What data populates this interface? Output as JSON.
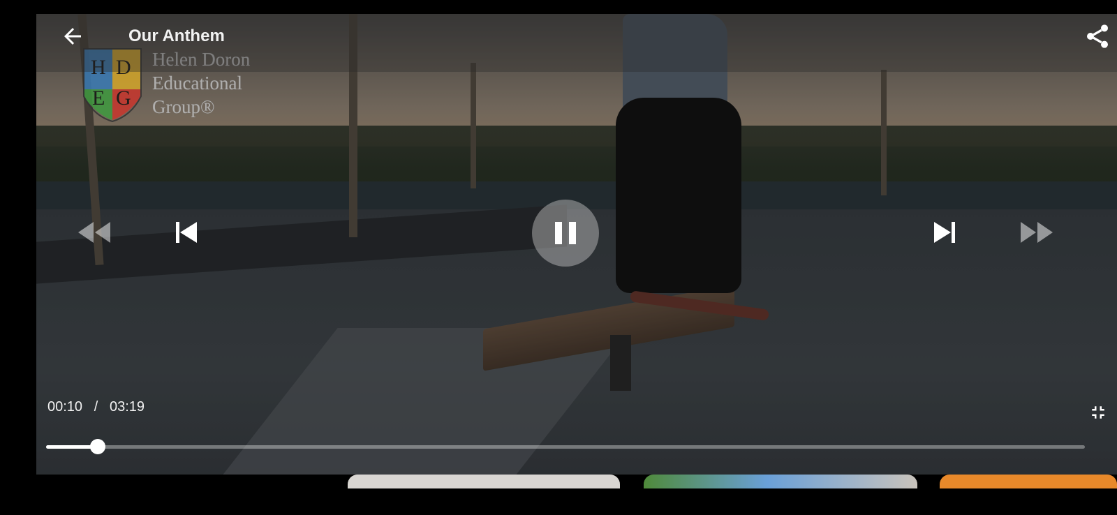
{
  "video": {
    "title": "Our Anthem",
    "current_time": "00:10",
    "separator": "/",
    "duration": "03:19",
    "progress_fraction": 0.05,
    "playing": true
  },
  "logo": {
    "letters": [
      "H",
      "D",
      "E",
      "G"
    ],
    "text_lines": [
      "Helen Doron",
      "Educational",
      "Group®"
    ]
  },
  "icons": {
    "back": "arrow-left-icon",
    "share": "share-icon",
    "rewind": "rewind-icon",
    "previous": "skip-previous-icon",
    "pause": "pause-icon",
    "next": "skip-next-icon",
    "fast_forward": "fast-forward-icon",
    "exit_fullscreen": "fullscreen-exit-icon"
  },
  "colors": {
    "accent": "#ffffff",
    "track": "#8a8a8a",
    "thumb_1": "#d9d6d2",
    "thumb_2": "#4f8a3a",
    "thumb_3": "#e8892a"
  }
}
